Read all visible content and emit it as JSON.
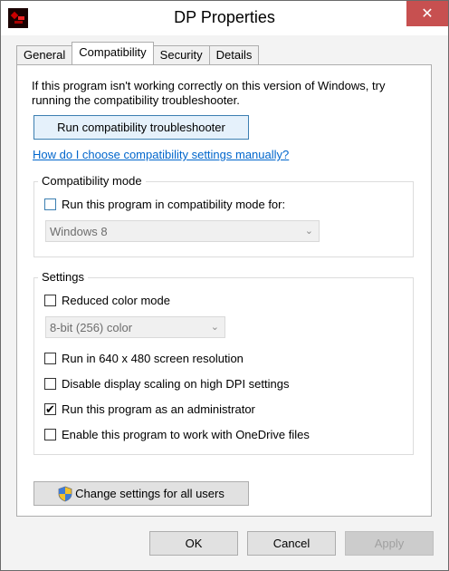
{
  "window": {
    "title": "DP Properties",
    "close_glyph": "✕"
  },
  "tabs": [
    "General",
    "Compatibility",
    "Security",
    "Details"
  ],
  "intro_text_line1": "If this program isn't working correctly on this version of Windows, try",
  "intro_text_line2": "running the compatibility troubleshooter.",
  "troubleshoot_button": "Run compatibility troubleshooter",
  "manual_link": "How do I choose compatibility settings manually?",
  "compat_mode": {
    "title": "Compatibility mode",
    "checkbox_label": "Run this program in compatibility mode for:",
    "checked": false,
    "selected_os": "Windows 8"
  },
  "settings": {
    "title": "Settings",
    "reduced_color": {
      "label": "Reduced color mode",
      "checked": false
    },
    "color_select": "8-bit (256) color",
    "items": [
      {
        "label": "Run in 640 x 480 screen resolution",
        "checked": false
      },
      {
        "label": "Disable display scaling on high DPI settings",
        "checked": false
      },
      {
        "label": "Run this program as an administrator",
        "checked": true
      },
      {
        "label": "Enable this program to work with OneDrive files",
        "checked": false
      }
    ]
  },
  "change_all_button": "Change settings for all users",
  "footer": {
    "ok": "OK",
    "cancel": "Cancel",
    "apply": "Apply"
  },
  "check_glyph": "✔",
  "colors": {
    "accent": "#0066cc",
    "close": "#c75050"
  }
}
